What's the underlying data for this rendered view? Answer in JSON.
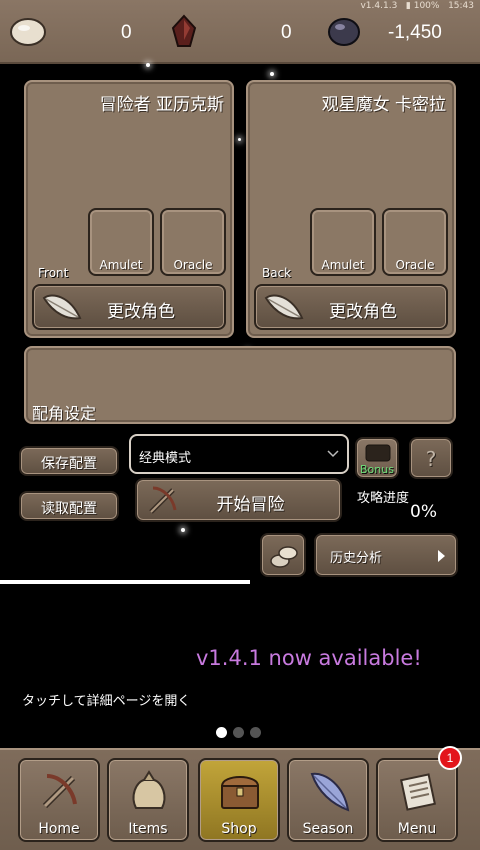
{
  "status_bar": {
    "version": "v1.4.1.3",
    "battery": "100%",
    "time": "15:43"
  },
  "resources": [
    {
      "name": "stone",
      "value": "0",
      "icon": "stone-icon"
    },
    {
      "name": "red-gem",
      "value": "0",
      "icon": "red-gem-icon"
    },
    {
      "name": "dark-gem",
      "value": "-1,450",
      "icon": "dark-gem-icon"
    }
  ],
  "front_panel": {
    "title": "冒险者 亚历克斯",
    "position": "Front",
    "amulet": "Amulet",
    "oracle": "Oracle",
    "change_button": "更改角色"
  },
  "back_panel": {
    "title": "观星魔女 卡密拉",
    "position": "Back",
    "amulet": "Amulet",
    "oracle": "Oracle",
    "change_button": "更改角色"
  },
  "support_panel": {
    "label": "配角设定"
  },
  "controls": {
    "save_button": "保存配置",
    "load_button": "读取配置",
    "mode_select": "经典模式",
    "bonus_label": "Bonus",
    "help_label": "?",
    "start_button": "开始冒险",
    "progress_label": "攻略进度",
    "progress_value": "0%",
    "history_button": "历史分析"
  },
  "news": {
    "update_text": "v1.4.1 now available!",
    "tap_text": "タッチして詳細ページを開く",
    "active_page": 1,
    "page_count": 3
  },
  "nav": {
    "items": [
      {
        "label": "Home",
        "icon": "crossbow-icon"
      },
      {
        "label": "Items",
        "icon": "bag-icon"
      },
      {
        "label": "Shop",
        "icon": "chest-icon"
      },
      {
        "label": "Season",
        "icon": "feather-icon"
      },
      {
        "label": "Menu",
        "icon": "scroll-icon"
      }
    ],
    "active": "Shop",
    "menu_badge": "1"
  },
  "colors": {
    "accent_update": "#c87adf",
    "panel": "#8b7865",
    "active_nav": "#c2a53a",
    "badge": "#e3151b"
  }
}
